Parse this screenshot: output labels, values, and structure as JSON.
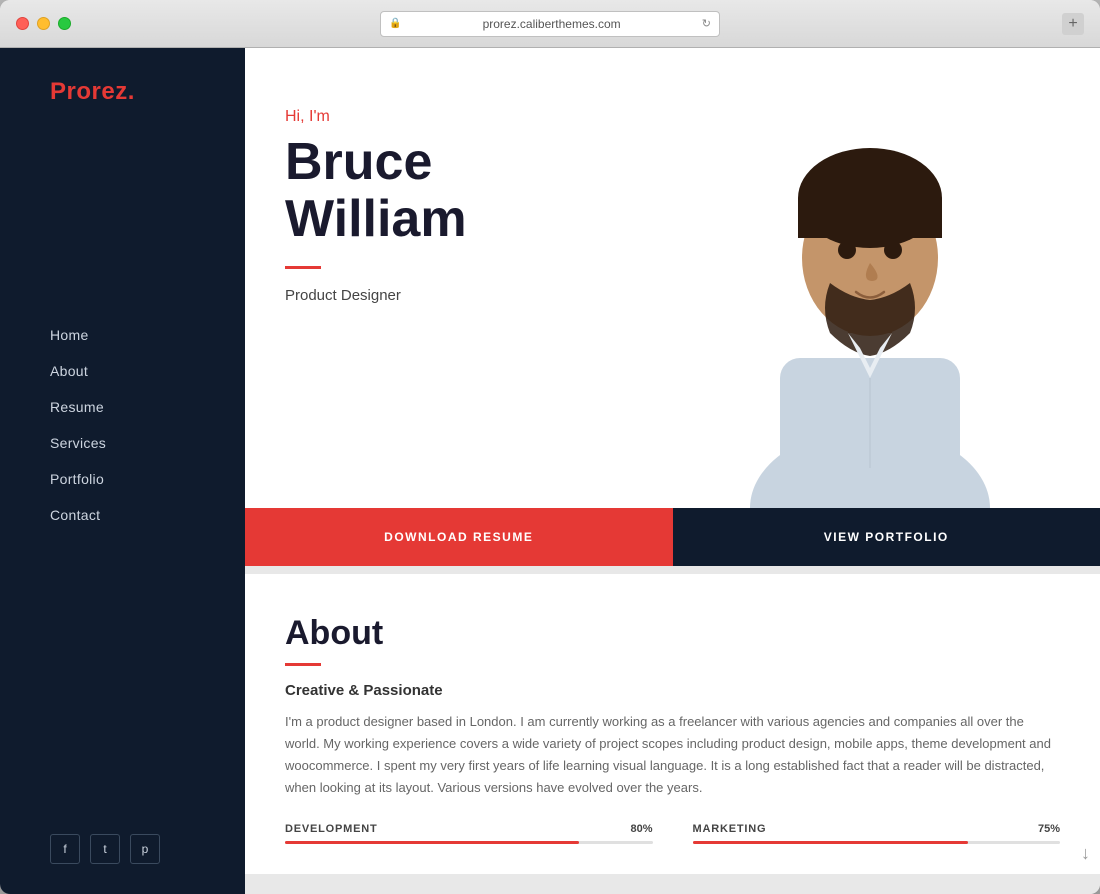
{
  "window": {
    "url": "prorez.caliberthemes.com",
    "add_tab_label": "+"
  },
  "logo": {
    "text": "Prorez",
    "dot": "."
  },
  "nav": {
    "items": [
      {
        "label": "Home",
        "id": "home"
      },
      {
        "label": "About",
        "id": "about"
      },
      {
        "label": "Resume",
        "id": "resume"
      },
      {
        "label": "Services",
        "id": "services"
      },
      {
        "label": "Portfolio",
        "id": "portfolio"
      },
      {
        "label": "Contact",
        "id": "contact"
      }
    ]
  },
  "social": {
    "items": [
      {
        "label": "f",
        "name": "facebook"
      },
      {
        "label": "t",
        "name": "twitter"
      },
      {
        "label": "p",
        "name": "pinterest"
      }
    ]
  },
  "hero": {
    "greeting": "Hi, I'm",
    "name_line1": "Bruce",
    "name_line2": "William",
    "title": "Product Designer",
    "download_label": "DOWNLOAD RESUME",
    "portfolio_label": "VIEW PORTFOLIO"
  },
  "about": {
    "title": "About",
    "subtitle": "Creative & Passionate",
    "body": "I'm a product designer based in London. I am currently working as a freelancer with various agencies and companies all over the world. My working experience covers a wide variety of project scopes including product design, mobile apps, theme development and woocommerce. I spent my very first years of life learning visual language. It is a long established fact that a reader will be distracted, when looking at its layout. Various versions have evolved over the years.",
    "skills": [
      {
        "name": "DEVELOPMENT",
        "percent": 80,
        "label": "80%"
      },
      {
        "name": "MARKETING",
        "percent": 75,
        "label": "75%"
      }
    ]
  },
  "colors": {
    "accent": "#e53935",
    "dark": "#0f1b2d",
    "text": "#444444"
  }
}
